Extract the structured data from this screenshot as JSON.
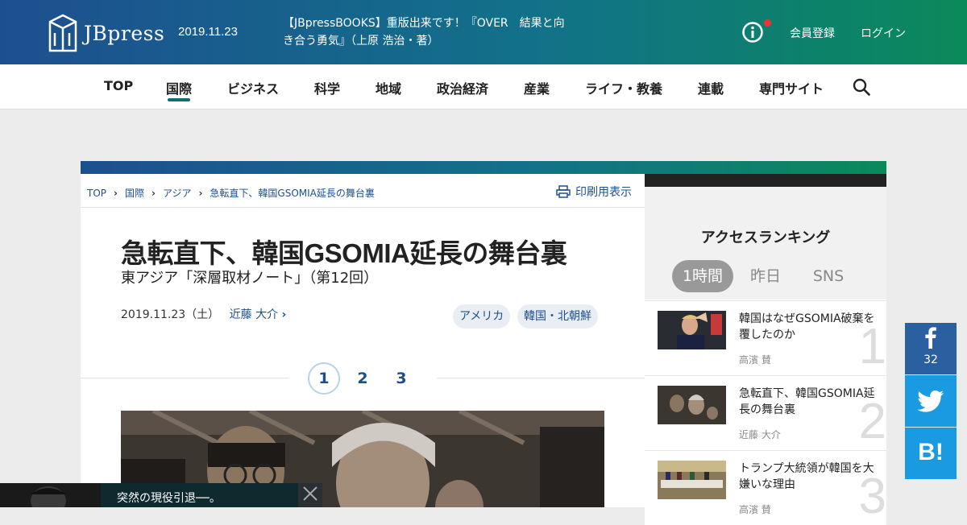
{
  "header": {
    "logo_text": "JBpress",
    "date": "2019.11.23",
    "notice": "【JBpressBOOKS】重版出来です！『OVER　結果と向き合う勇気』（上原 浩治・著）",
    "register": "会員登録",
    "login": "ログイン"
  },
  "nav": {
    "items": [
      "TOP",
      "国際",
      "ビジネス",
      "科学",
      "地域",
      "政治経済",
      "産業",
      "ライフ・教養",
      "連載",
      "専門サイト"
    ]
  },
  "breadcrumb": [
    "TOP",
    "国際",
    "アジア",
    "急転直下、韓国GSOMIA延長の舞台裏"
  ],
  "print_label": "印刷用表示",
  "article": {
    "title": "急転直下、韓国GSOMIA延長の舞台裏",
    "subtitle": "東アジア「深層取材ノート」（第12回）",
    "date": "2019.11.23（土）",
    "author": "近藤 大介",
    "tags": [
      "アメリカ",
      "韓国・北朝鮮"
    ],
    "pages": [
      "1",
      "2",
      "3"
    ]
  },
  "ranking": {
    "title": "アクセスランキング",
    "tabs": [
      "1時間",
      "昨日",
      "SNS"
    ],
    "items": [
      {
        "rank": "1",
        "title": "韓国はなぜGSOMIA破棄を覆したのか",
        "author": "高濱 賛"
      },
      {
        "rank": "2",
        "title": "急転直下、韓国GSOMIA延長の舞台裏",
        "author": "近藤 大介"
      },
      {
        "rank": "3",
        "title": "トランプ大統領が韓国を大嫌いな理由",
        "author": "高濱 賛"
      }
    ]
  },
  "share": {
    "facebook_count": "32",
    "hatena_label": "B!"
  },
  "toast": {
    "text": "突然の現役引退──。"
  },
  "colors": {
    "brand_blue": "#1d4f8f",
    "brand_green": "#0a8a5a",
    "nav_accent": "#0d6e6e",
    "notification_dot": "#e33333",
    "facebook": "#2a5fa0",
    "twitter": "#1a9ae0"
  }
}
